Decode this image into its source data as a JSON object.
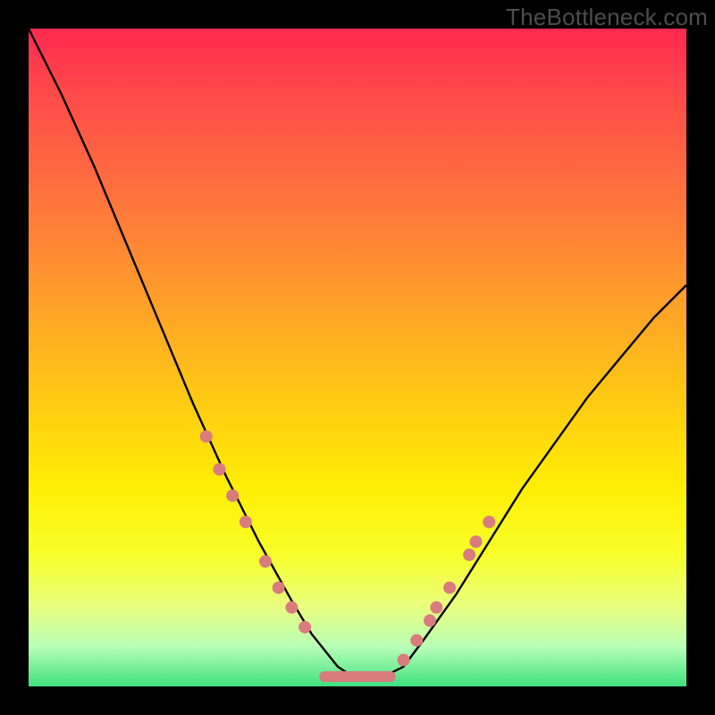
{
  "watermark": "TheBottleneck.com",
  "chart_data": {
    "type": "line",
    "title": "",
    "xlabel": "",
    "ylabel": "",
    "xlim": [
      0,
      100
    ],
    "ylim": [
      0,
      100
    ],
    "grid": false,
    "legend": false,
    "series": [
      {
        "name": "curve",
        "x": [
          0,
          5,
          10,
          15,
          20,
          25,
          30,
          35,
          40,
          43,
          47,
          50,
          53,
          57,
          60,
          65,
          70,
          75,
          80,
          85,
          90,
          95,
          100
        ],
        "values": [
          100,
          90,
          79,
          67,
          55,
          43,
          32,
          22,
          13,
          8,
          3,
          1,
          1,
          3,
          7,
          14,
          22,
          30,
          37,
          44,
          50,
          56,
          61
        ]
      }
    ],
    "markers": {
      "color": "#d97c7e",
      "radius_px": 7,
      "points": [
        {
          "x": 27,
          "y": 38
        },
        {
          "x": 29,
          "y": 33
        },
        {
          "x": 31,
          "y": 29
        },
        {
          "x": 33,
          "y": 25
        },
        {
          "x": 36,
          "y": 19
        },
        {
          "x": 38,
          "y": 15
        },
        {
          "x": 40,
          "y": 12
        },
        {
          "x": 42,
          "y": 9
        },
        {
          "x": 57,
          "y": 4
        },
        {
          "x": 59,
          "y": 7
        },
        {
          "x": 61,
          "y": 10
        },
        {
          "x": 62,
          "y": 12
        },
        {
          "x": 64,
          "y": 15
        },
        {
          "x": 67,
          "y": 20
        },
        {
          "x": 68,
          "y": 22
        },
        {
          "x": 70,
          "y": 25
        }
      ],
      "flat_segment": {
        "x0": 45,
        "x1": 55,
        "y": 1.5
      }
    },
    "background_gradient": {
      "top": "#ff2a4f",
      "bottom": "#3fe07f"
    }
  }
}
